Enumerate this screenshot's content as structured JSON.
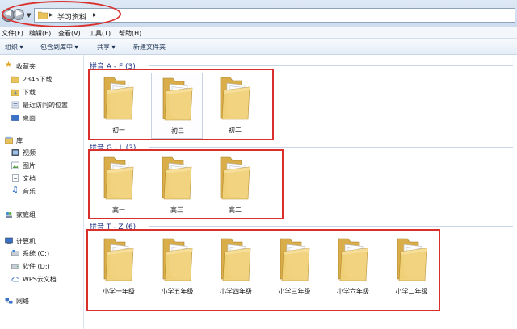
{
  "address": {
    "path_label": "学习资料"
  },
  "menu": [
    "文件(F)",
    "编辑(E)",
    "查看(V)",
    "工具(T)",
    "帮助(H)"
  ],
  "toolbar": {
    "organize": "组织 ▾",
    "include": "包含到库中 ▾",
    "share": "共享 ▾",
    "new_folder": "新建文件夹"
  },
  "sidebar": {
    "favorites": "收藏夹",
    "fav_items": [
      "2345下载",
      "下载",
      "最近访问的位置",
      "桌面"
    ],
    "library": "库",
    "lib_items": [
      "视频",
      "图片",
      "文档",
      "音乐"
    ],
    "homegroup": "家庭组",
    "computer": "计算机",
    "comp_items": [
      "系统 (C:)",
      "软件 (D:)",
      "WPS云文档"
    ],
    "network": "网络"
  },
  "groups": [
    {
      "header": "拼音 A - F (3)",
      "items": [
        "初一",
        "初三",
        "初二"
      ]
    },
    {
      "header": "拼音 G - L (3)",
      "items": [
        "高一",
        "高三",
        "高二"
      ]
    },
    {
      "header": "拼音 T - Z (6)",
      "items": [
        "小学一年级",
        "小学五年级",
        "小学四年级",
        "小学三年级",
        "小学六年级",
        "小学二年级"
      ]
    }
  ],
  "colors": {
    "annotation_red": "#d9302c",
    "group_header_blue": "#1e3287",
    "folder_yellow": "#f2d27a"
  }
}
